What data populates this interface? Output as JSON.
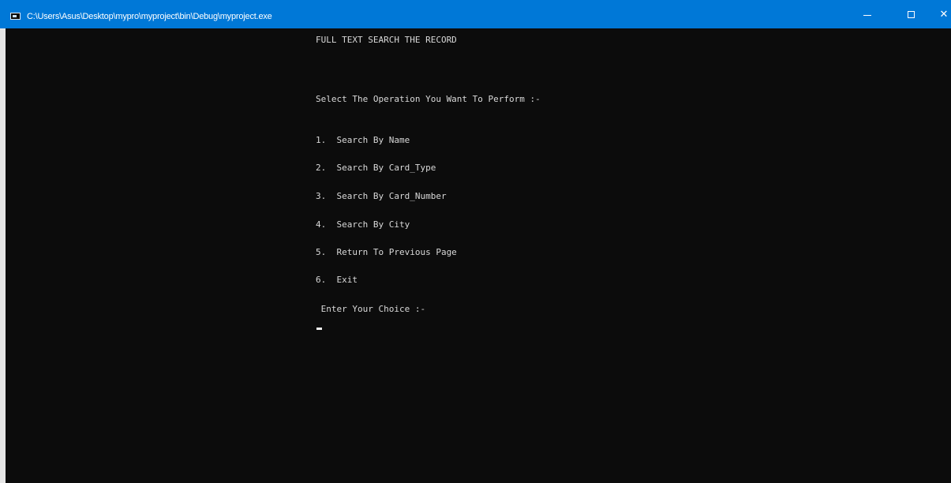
{
  "window": {
    "title": "C:\\Users\\Asus\\Desktop\\mypro\\myproject\\bin\\Debug\\myproject.exe",
    "icon": "console-app-icon",
    "controls": {
      "minimize_icon": "minimize-icon",
      "maximize_icon": "maximize-icon",
      "close_icon": "close-icon",
      "close_glyph": "✕"
    }
  },
  "console": {
    "heading": "FULL TEXT SEARCH THE RECORD",
    "prompt": "Select The Operation You Want To Perform :-",
    "options": [
      "1.  Search By Name",
      "2.  Search By Card_Type",
      "3.  Search By Card_Number",
      "4.  Search By City",
      "5.  Return To Previous Page",
      "6.  Exit"
    ],
    "input_prompt": " Enter Your Choice :-"
  },
  "colors": {
    "titlebar": "#0078d7",
    "console_bg": "#0c0c0c",
    "console_text": "#d9d9d9"
  }
}
